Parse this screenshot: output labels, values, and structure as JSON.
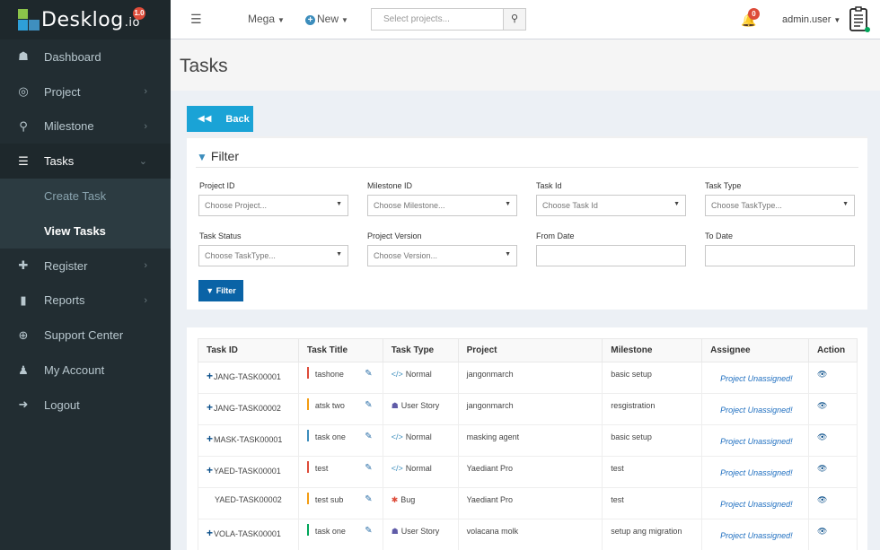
{
  "brand": {
    "name": "Desklog",
    "suffix": ".io",
    "version": "1.0"
  },
  "sidebar": {
    "items": [
      {
        "label": "Dashboard",
        "icon": "dashboard-icon",
        "glyph": "☗",
        "chevron": false
      },
      {
        "label": "Project",
        "icon": "target-icon",
        "glyph": "◎",
        "chevron": true
      },
      {
        "label": "Milestone",
        "icon": "map-marker-icon",
        "glyph": "⚲",
        "chevron": true
      },
      {
        "label": "Tasks",
        "icon": "tasks-icon",
        "glyph": "☰",
        "chevron": true,
        "active": true
      },
      {
        "label": "Register",
        "icon": "plus-icon",
        "glyph": "✚",
        "chevron": true
      },
      {
        "label": "Reports",
        "icon": "bar-chart-icon",
        "glyph": "▮",
        "chevron": true
      },
      {
        "label": "Support Center",
        "icon": "lifebuoy-icon",
        "glyph": "⊕",
        "chevron": false
      },
      {
        "label": "My Account",
        "icon": "user-icon",
        "glyph": "♟",
        "chevron": false
      },
      {
        "label": "Logout",
        "icon": "sign-out-icon",
        "glyph": "➜",
        "chevron": false
      }
    ],
    "sub_items": [
      {
        "label": "Create Task"
      },
      {
        "label": "View Tasks"
      }
    ]
  },
  "header": {
    "mega": "Mega",
    "new": "New",
    "search_placeholder": "Select projects...",
    "notifications": "0",
    "user": "admin.user"
  },
  "page": {
    "title": "Tasks",
    "back": "Back"
  },
  "filter": {
    "title": "Filter",
    "fields": {
      "project_id": {
        "label": "Project ID",
        "value": "Choose Project..."
      },
      "milestone_id": {
        "label": "Milestone ID",
        "value": "Choose Milestone..."
      },
      "task_id": {
        "label": "Task Id",
        "value": "Choose Task Id"
      },
      "task_type": {
        "label": "Task Type",
        "value": "Choose TaskType..."
      },
      "task_status": {
        "label": "Task Status",
        "value": "Choose TaskType..."
      },
      "project_version": {
        "label": "Project Version",
        "value": "Choose Version..."
      },
      "from_date": {
        "label": "From Date",
        "value": ""
      },
      "to_date": {
        "label": "To Date",
        "value": ""
      }
    },
    "button": "Filter"
  },
  "table": {
    "columns": [
      "Task ID",
      "Task Title",
      "Task Type",
      "Project",
      "Milestone",
      "Assignee",
      "Action"
    ],
    "rows": [
      {
        "id": "JANG-TASK00001",
        "expand": true,
        "title": "tashone",
        "color": "#dd4b39",
        "type": "Normal",
        "type_icon": "code-icon",
        "project": "jangonmarch",
        "milestone": "basic setup",
        "assignee": "Project Unassigned!"
      },
      {
        "id": "JANG-TASK00002",
        "expand": true,
        "title": "atsk two",
        "color": "#f39c12",
        "type": "User Story",
        "type_icon": "users-icon",
        "project": "jangonmarch",
        "milestone": "resgistration",
        "assignee": "Project Unassigned!"
      },
      {
        "id": "MASK-TASK00001",
        "expand": true,
        "title": "task one",
        "color": "#3c8dbc",
        "type": "Normal",
        "type_icon": "code-icon",
        "project": "masking agent",
        "milestone": "basic setup",
        "assignee": "Project Unassigned!"
      },
      {
        "id": "YAED-TASK00001",
        "expand": true,
        "title": "test",
        "color": "#dd4b39",
        "type": "Normal",
        "type_icon": "code-icon",
        "project": "Yaediant Pro",
        "milestone": "test",
        "assignee": "Project Unassigned!"
      },
      {
        "id": "YAED-TASK00002",
        "expand": false,
        "title": "test sub",
        "color": "#f39c12",
        "type": "Bug",
        "type_icon": "bug-icon",
        "project": "Yaediant Pro",
        "milestone": "test",
        "assignee": "Project Unassigned!"
      },
      {
        "id": "VOLA-TASK00001",
        "expand": true,
        "title": "task one",
        "color": "#00a65a",
        "type": "User Story",
        "type_icon": "users-icon",
        "project": "volacana molk",
        "milestone": "setup ang migration",
        "assignee": "Project Unassigned!"
      }
    ]
  }
}
